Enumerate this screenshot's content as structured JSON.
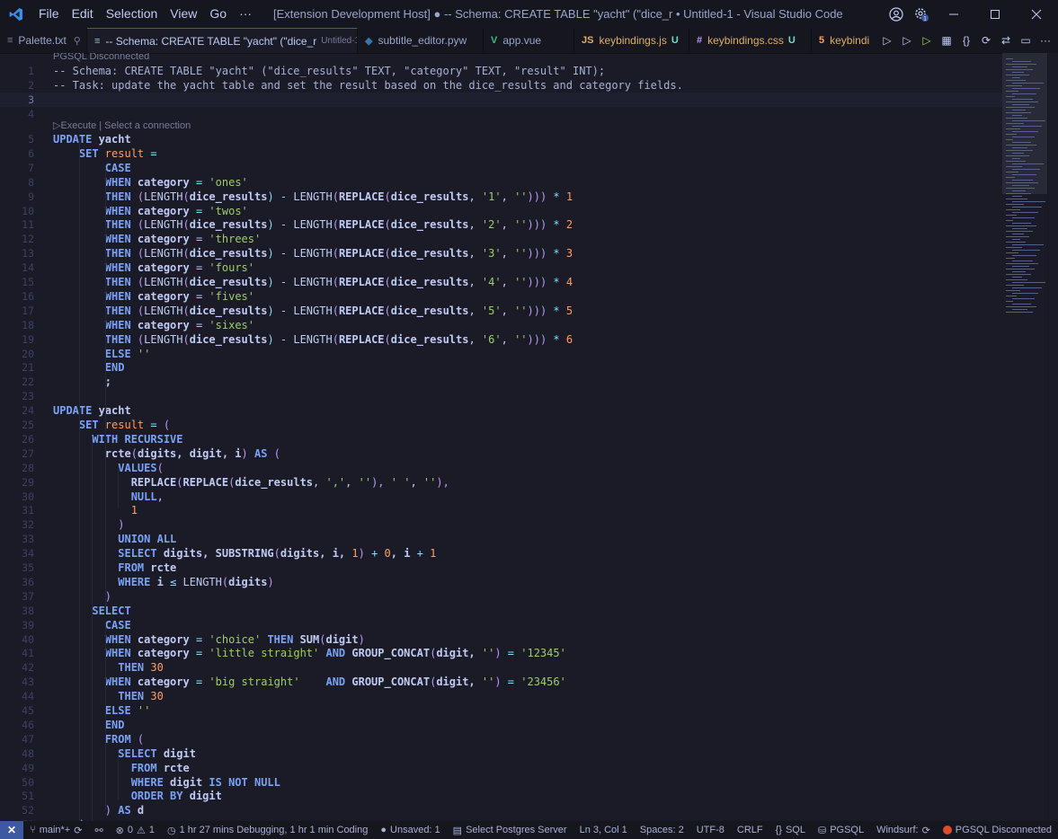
{
  "titlebar": {
    "menu": [
      "File",
      "Edit",
      "Selection",
      "View",
      "Go",
      "···"
    ],
    "title": "[Extension Development Host] ● -- Schema: CREATE TABLE \"yacht\" (\"dice_r • Untitled-1 - Visual Studio Code"
  },
  "tabs": [
    {
      "label": "Palette.txt",
      "icon": "text-file-icon"
    },
    {
      "label": "-- Schema: CREATE TABLE \"yacht\" (\"dice_r",
      "sub": "Untitled-1",
      "dirty": "●",
      "icon": "sql-file-icon"
    },
    {
      "label": "subtitle_editor.pyw",
      "icon": "python-icon"
    },
    {
      "label": "app.vue",
      "icon": "vue-icon"
    },
    {
      "label": "keybindings.js",
      "badge": "U",
      "icon": "js-icon"
    },
    {
      "label": "keybindings.css",
      "badge": "U",
      "icon": "css-icon"
    },
    {
      "label": "keybindi",
      "icon": "html-icon"
    }
  ],
  "codelens": "▷Execute | Select a connection",
  "pg_status_header": "PGSQL Disconnected",
  "editor": {
    "current_line": 3,
    "lines": [
      [
        {
          "t": "-- Schema: CREATE TABLE \"yacht\" (\"dice_results\" TEXT, \"category\" TEXT, \"result\" INT);",
          "c": "cm"
        }
      ],
      [
        {
          "t": "-- Task: update the yacht table and set the result based on the dice_results and category fields.",
          "c": "cm"
        }
      ],
      [],
      [],
      [
        {
          "t": "UPDATE",
          "c": "kw"
        },
        {
          "t": " yacht",
          "c": "id"
        }
      ],
      [
        {
          "t": "    SET",
          "c": "kw"
        },
        {
          "t": " result",
          "c": "num"
        },
        {
          "t": " =",
          "c": "op"
        }
      ],
      [
        {
          "t": "        CASE",
          "c": "kw"
        }
      ],
      [
        {
          "t": "        WHEN",
          "c": "kw"
        },
        {
          "t": " category",
          "c": "id"
        },
        {
          "t": " = ",
          "c": "op"
        },
        {
          "t": "'ones'",
          "c": "str"
        }
      ],
      [
        {
          "t": "        THEN",
          "c": "kw"
        },
        {
          "t": " (",
          "c": "pn"
        },
        {
          "t": "LENGTH",
          "c": "fn"
        },
        {
          "t": "(",
          "c": "pn"
        },
        {
          "t": "dice_results",
          "c": "id"
        },
        {
          "t": ") - ",
          "c": "op"
        },
        {
          "t": "LENGTH",
          "c": "fn"
        },
        {
          "t": "(",
          "c": "pn"
        },
        {
          "t": "REPLACE",
          "c": "id"
        },
        {
          "t": "(",
          "c": "pn"
        },
        {
          "t": "dice_results",
          "c": "id"
        },
        {
          "t": ", ",
          "c": "fn"
        },
        {
          "t": "'1'",
          "c": "str"
        },
        {
          "t": ", ",
          "c": "fn"
        },
        {
          "t": "''",
          "c": "str"
        },
        {
          "t": "))) ",
          "c": "pn"
        },
        {
          "t": "* ",
          "c": "op"
        },
        {
          "t": "1",
          "c": "num"
        }
      ],
      [
        {
          "t": "        WHEN",
          "c": "kw"
        },
        {
          "t": " category",
          "c": "id"
        },
        {
          "t": " = ",
          "c": "op"
        },
        {
          "t": "'twos'",
          "c": "str"
        }
      ],
      [
        {
          "t": "        THEN",
          "c": "kw"
        },
        {
          "t": " (",
          "c": "pn"
        },
        {
          "t": "LENGTH",
          "c": "fn"
        },
        {
          "t": "(",
          "c": "pn"
        },
        {
          "t": "dice_results",
          "c": "id"
        },
        {
          "t": ") - ",
          "c": "op"
        },
        {
          "t": "LENGTH",
          "c": "fn"
        },
        {
          "t": "(",
          "c": "pn"
        },
        {
          "t": "REPLACE",
          "c": "id"
        },
        {
          "t": "(",
          "c": "pn"
        },
        {
          "t": "dice_results",
          "c": "id"
        },
        {
          "t": ", ",
          "c": "fn"
        },
        {
          "t": "'2'",
          "c": "str"
        },
        {
          "t": ", ",
          "c": "fn"
        },
        {
          "t": "''",
          "c": "str"
        },
        {
          "t": "))) ",
          "c": "pn"
        },
        {
          "t": "* ",
          "c": "op"
        },
        {
          "t": "2",
          "c": "num"
        }
      ],
      [
        {
          "t": "        WHEN",
          "c": "kw"
        },
        {
          "t": " category",
          "c": "id"
        },
        {
          "t": " = ",
          "c": "op"
        },
        {
          "t": "'threes'",
          "c": "str"
        }
      ],
      [
        {
          "t": "        THEN",
          "c": "kw"
        },
        {
          "t": " (",
          "c": "pn"
        },
        {
          "t": "LENGTH",
          "c": "fn"
        },
        {
          "t": "(",
          "c": "pn"
        },
        {
          "t": "dice_results",
          "c": "id"
        },
        {
          "t": ") - ",
          "c": "op"
        },
        {
          "t": "LENGTH",
          "c": "fn"
        },
        {
          "t": "(",
          "c": "pn"
        },
        {
          "t": "REPLACE",
          "c": "id"
        },
        {
          "t": "(",
          "c": "pn"
        },
        {
          "t": "dice_results",
          "c": "id"
        },
        {
          "t": ", ",
          "c": "fn"
        },
        {
          "t": "'3'",
          "c": "str"
        },
        {
          "t": ", ",
          "c": "fn"
        },
        {
          "t": "''",
          "c": "str"
        },
        {
          "t": "))) ",
          "c": "pn"
        },
        {
          "t": "* ",
          "c": "op"
        },
        {
          "t": "3",
          "c": "num"
        }
      ],
      [
        {
          "t": "        WHEN",
          "c": "kw"
        },
        {
          "t": " category",
          "c": "id"
        },
        {
          "t": " = ",
          "c": "op"
        },
        {
          "t": "'fours'",
          "c": "str"
        }
      ],
      [
        {
          "t": "        THEN",
          "c": "kw"
        },
        {
          "t": " (",
          "c": "pn"
        },
        {
          "t": "LENGTH",
          "c": "fn"
        },
        {
          "t": "(",
          "c": "pn"
        },
        {
          "t": "dice_results",
          "c": "id"
        },
        {
          "t": ") - ",
          "c": "op"
        },
        {
          "t": "LENGTH",
          "c": "fn"
        },
        {
          "t": "(",
          "c": "pn"
        },
        {
          "t": "REPLACE",
          "c": "id"
        },
        {
          "t": "(",
          "c": "pn"
        },
        {
          "t": "dice_results",
          "c": "id"
        },
        {
          "t": ", ",
          "c": "fn"
        },
        {
          "t": "'4'",
          "c": "str"
        },
        {
          "t": ", ",
          "c": "fn"
        },
        {
          "t": "''",
          "c": "str"
        },
        {
          "t": "))) ",
          "c": "pn"
        },
        {
          "t": "* ",
          "c": "op"
        },
        {
          "t": "4",
          "c": "num"
        }
      ],
      [
        {
          "t": "        WHEN",
          "c": "kw"
        },
        {
          "t": " category",
          "c": "id"
        },
        {
          "t": " = ",
          "c": "op"
        },
        {
          "t": "'fives'",
          "c": "str"
        }
      ],
      [
        {
          "t": "        THEN",
          "c": "kw"
        },
        {
          "t": " (",
          "c": "pn"
        },
        {
          "t": "LENGTH",
          "c": "fn"
        },
        {
          "t": "(",
          "c": "pn"
        },
        {
          "t": "dice_results",
          "c": "id"
        },
        {
          "t": ") - ",
          "c": "op"
        },
        {
          "t": "LENGTH",
          "c": "fn"
        },
        {
          "t": "(",
          "c": "pn"
        },
        {
          "t": "REPLACE",
          "c": "id"
        },
        {
          "t": "(",
          "c": "pn"
        },
        {
          "t": "dice_results",
          "c": "id"
        },
        {
          "t": ", ",
          "c": "fn"
        },
        {
          "t": "'5'",
          "c": "str"
        },
        {
          "t": ", ",
          "c": "fn"
        },
        {
          "t": "''",
          "c": "str"
        },
        {
          "t": "))) ",
          "c": "pn"
        },
        {
          "t": "* ",
          "c": "op"
        },
        {
          "t": "5",
          "c": "num"
        }
      ],
      [
        {
          "t": "        WHEN",
          "c": "kw"
        },
        {
          "t": " category",
          "c": "id"
        },
        {
          "t": " = ",
          "c": "op"
        },
        {
          "t": "'sixes'",
          "c": "str"
        }
      ],
      [
        {
          "t": "        THEN",
          "c": "kw"
        },
        {
          "t": " (",
          "c": "pn"
        },
        {
          "t": "LENGTH",
          "c": "fn"
        },
        {
          "t": "(",
          "c": "pn"
        },
        {
          "t": "dice_results",
          "c": "id"
        },
        {
          "t": ") - ",
          "c": "op"
        },
        {
          "t": "LENGTH",
          "c": "fn"
        },
        {
          "t": "(",
          "c": "pn"
        },
        {
          "t": "REPLACE",
          "c": "id"
        },
        {
          "t": "(",
          "c": "pn"
        },
        {
          "t": "dice_results",
          "c": "id"
        },
        {
          "t": ", ",
          "c": "fn"
        },
        {
          "t": "'6'",
          "c": "str"
        },
        {
          "t": ", ",
          "c": "fn"
        },
        {
          "t": "''",
          "c": "str"
        },
        {
          "t": "))) ",
          "c": "pn"
        },
        {
          "t": "* ",
          "c": "op"
        },
        {
          "t": "6",
          "c": "num"
        }
      ],
      [
        {
          "t": "        ELSE",
          "c": "kw"
        },
        {
          "t": " ''",
          "c": "str"
        }
      ],
      [
        {
          "t": "        END",
          "c": "kw"
        }
      ],
      [
        {
          "t": "        ;",
          "c": "id"
        }
      ],
      [],
      [
        {
          "t": "UPDATE",
          "c": "kw"
        },
        {
          "t": " yacht",
          "c": "id"
        }
      ],
      [
        {
          "t": "    SET",
          "c": "kw"
        },
        {
          "t": " result",
          "c": "num"
        },
        {
          "t": " = ",
          "c": "op"
        },
        {
          "t": "(",
          "c": "pn"
        }
      ],
      [
        {
          "t": "      WITH RECURSIVE",
          "c": "kw"
        }
      ],
      [
        {
          "t": "        rcte",
          "c": "id"
        },
        {
          "t": "(",
          "c": "pn"
        },
        {
          "t": "digits, digit, i",
          "c": "id"
        },
        {
          "t": ") ",
          "c": "pn"
        },
        {
          "t": "AS",
          "c": "kw"
        },
        {
          "t": " (",
          "c": "pn"
        }
      ],
      [
        {
          "t": "          VALUES",
          "c": "kw"
        },
        {
          "t": "(",
          "c": "pn"
        }
      ],
      [
        {
          "t": "            REPLACE",
          "c": "id"
        },
        {
          "t": "(",
          "c": "pn"
        },
        {
          "t": "REPLACE",
          "c": "id"
        },
        {
          "t": "(",
          "c": "pn"
        },
        {
          "t": "dice_results",
          "c": "id"
        },
        {
          "t": ", ",
          "c": "fn"
        },
        {
          "t": "','",
          "c": "str"
        },
        {
          "t": ", ",
          "c": "fn"
        },
        {
          "t": "''",
          "c": "str"
        },
        {
          "t": "), ",
          "c": "pn"
        },
        {
          "t": "' '",
          "c": "str"
        },
        {
          "t": ", ",
          "c": "fn"
        },
        {
          "t": "''",
          "c": "str"
        },
        {
          "t": "),",
          "c": "pn"
        }
      ],
      [
        {
          "t": "            NULL",
          "c": "kw"
        },
        {
          "t": ",",
          "c": "fn"
        }
      ],
      [
        {
          "t": "            1",
          "c": "num"
        }
      ],
      [
        {
          "t": "          )",
          "c": "pn"
        }
      ],
      [
        {
          "t": "          UNION ALL",
          "c": "kw"
        }
      ],
      [
        {
          "t": "          SELECT",
          "c": "kw"
        },
        {
          "t": " digits, ",
          "c": "id"
        },
        {
          "t": "SUBSTRING",
          "c": "id"
        },
        {
          "t": "(",
          "c": "pn"
        },
        {
          "t": "digits, i, ",
          "c": "id"
        },
        {
          "t": "1",
          "c": "num"
        },
        {
          "t": ") ",
          "c": "pn"
        },
        {
          "t": "+ ",
          "c": "op"
        },
        {
          "t": "0",
          "c": "num"
        },
        {
          "t": ", i ",
          "c": "id"
        },
        {
          "t": "+ ",
          "c": "op"
        },
        {
          "t": "1",
          "c": "num"
        }
      ],
      [
        {
          "t": "          FROM",
          "c": "kw"
        },
        {
          "t": " rcte",
          "c": "id"
        }
      ],
      [
        {
          "t": "          WHERE",
          "c": "kw"
        },
        {
          "t": " i ",
          "c": "id"
        },
        {
          "t": "≤ ",
          "c": "op"
        },
        {
          "t": "LENGTH",
          "c": "fn"
        },
        {
          "t": "(",
          "c": "pn"
        },
        {
          "t": "digits",
          "c": "id"
        },
        {
          "t": ")",
          "c": "pn"
        }
      ],
      [
        {
          "t": "        )",
          "c": "pn"
        }
      ],
      [
        {
          "t": "      SELECT",
          "c": "kw"
        }
      ],
      [
        {
          "t": "        CASE",
          "c": "kw"
        }
      ],
      [
        {
          "t": "        WHEN",
          "c": "kw"
        },
        {
          "t": " category",
          "c": "id"
        },
        {
          "t": " = ",
          "c": "op"
        },
        {
          "t": "'choice'",
          "c": "str"
        },
        {
          "t": " THEN",
          "c": "kw"
        },
        {
          "t": " SUM",
          "c": "id"
        },
        {
          "t": "(",
          "c": "pn"
        },
        {
          "t": "digit",
          "c": "id"
        },
        {
          "t": ")",
          "c": "pn"
        }
      ],
      [
        {
          "t": "        WHEN",
          "c": "kw"
        },
        {
          "t": " category",
          "c": "id"
        },
        {
          "t": " = ",
          "c": "op"
        },
        {
          "t": "'little straight'",
          "c": "str"
        },
        {
          "t": " AND",
          "c": "kw"
        },
        {
          "t": " GROUP_CONCAT",
          "c": "id"
        },
        {
          "t": "(",
          "c": "pn"
        },
        {
          "t": "digit, ",
          "c": "id"
        },
        {
          "t": "''",
          "c": "str"
        },
        {
          "t": ") ",
          "c": "pn"
        },
        {
          "t": "= ",
          "c": "op"
        },
        {
          "t": "'12345'",
          "c": "str"
        }
      ],
      [
        {
          "t": "          THEN",
          "c": "kw"
        },
        {
          "t": " 30",
          "c": "num"
        }
      ],
      [
        {
          "t": "        WHEN",
          "c": "kw"
        },
        {
          "t": " category",
          "c": "id"
        },
        {
          "t": " = ",
          "c": "op"
        },
        {
          "t": "'big straight'",
          "c": "str"
        },
        {
          "t": "    AND",
          "c": "kw"
        },
        {
          "t": " GROUP_CONCAT",
          "c": "id"
        },
        {
          "t": "(",
          "c": "pn"
        },
        {
          "t": "digit, ",
          "c": "id"
        },
        {
          "t": "''",
          "c": "str"
        },
        {
          "t": ") ",
          "c": "pn"
        },
        {
          "t": "= ",
          "c": "op"
        },
        {
          "t": "'23456'",
          "c": "str"
        }
      ],
      [
        {
          "t": "          THEN",
          "c": "kw"
        },
        {
          "t": " 30",
          "c": "num"
        }
      ],
      [
        {
          "t": "        ELSE",
          "c": "kw"
        },
        {
          "t": " ''",
          "c": "str"
        }
      ],
      [
        {
          "t": "        END",
          "c": "kw"
        }
      ],
      [
        {
          "t": "        FROM",
          "c": "kw"
        },
        {
          "t": " (",
          "c": "pn"
        }
      ],
      [
        {
          "t": "          SELECT",
          "c": "kw"
        },
        {
          "t": " digit",
          "c": "id"
        }
      ],
      [
        {
          "t": "            FROM",
          "c": "kw"
        },
        {
          "t": " rcte",
          "c": "id"
        }
      ],
      [
        {
          "t": "            WHERE",
          "c": "kw"
        },
        {
          "t": " digit ",
          "c": "id"
        },
        {
          "t": "IS NOT NULL",
          "c": "kw"
        }
      ],
      [
        {
          "t": "            ORDER BY",
          "c": "kw"
        },
        {
          "t": " digit",
          "c": "id"
        }
      ],
      [
        {
          "t": "        ) ",
          "c": "pn"
        },
        {
          "t": "AS",
          "c": "kw"
        },
        {
          "t": " d",
          "c": "id"
        }
      ],
      [
        {
          "t": "    )",
          "c": "pn"
        }
      ]
    ]
  },
  "statusbar": {
    "branch": "main*+",
    "problems": "0",
    "warnings": "1",
    "time": "1 hr 27 mins Debugging, 1 hr 1 min Coding",
    "unsaved": "Unsaved: 1",
    "server": "Select Postgres Server",
    "position": "Ln 3, Col 1",
    "spaces": "Spaces: 2",
    "encoding": "UTF-8",
    "eol": "CRLF",
    "language": "SQL",
    "pgsql": "PGSQL",
    "windsurf": "Windsurf:",
    "disconnected": "PGSQL Disconnected"
  },
  "colors": {
    "accent": "#3d59a1",
    "keyword": "#7aa2f7",
    "string": "#9ece6a",
    "number": "#ff9e64",
    "error": "#e04a2e"
  }
}
